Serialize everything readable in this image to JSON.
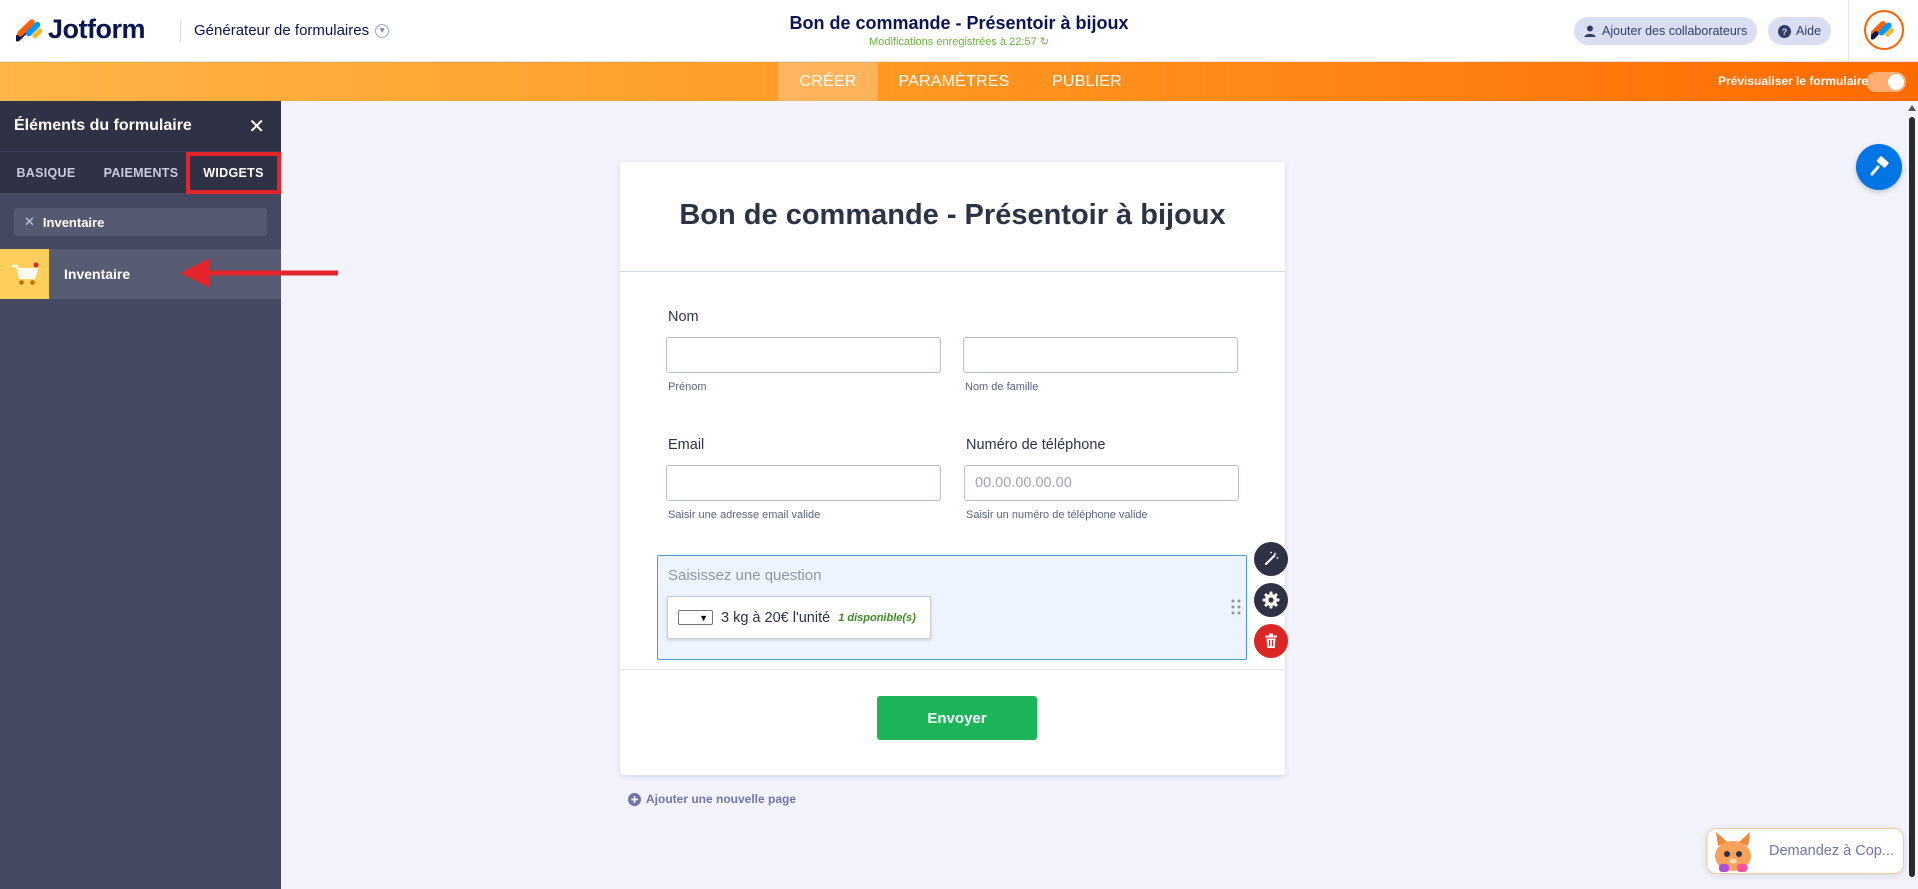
{
  "header": {
    "brand": "Jotform",
    "builder_title": "Générateur de formulaires",
    "form_title": "Bon de commande - Présentoir à bijoux",
    "save_status": "Modifications enregistrées à 22:57",
    "collab_label": "Ajouter des collaborateurs",
    "help_label": "Aide"
  },
  "nav": {
    "tabs": [
      {
        "label": "CRÉER",
        "active": true
      },
      {
        "label": "PARAMÈTRES",
        "active": false
      },
      {
        "label": "PUBLIER",
        "active": false
      }
    ],
    "preview_label": "Prévisualiser le formulaire",
    "preview_on": false
  },
  "panel": {
    "title": "Éléments du formulaire",
    "tabs": [
      {
        "label": "BASIQUE",
        "active": false
      },
      {
        "label": "PAIEMENTS",
        "active": false
      },
      {
        "label": "WIDGETS",
        "active": true
      }
    ],
    "search_value": "Inventaire",
    "results": [
      {
        "label": "Inventaire",
        "icon": "shopping-cart-icon"
      }
    ]
  },
  "form": {
    "title": "Bon de commande - Présentoir à bijoux",
    "name_label": "Nom",
    "first_sub": "Prénom",
    "last_sub": "Nom de famille",
    "email_label": "Email",
    "email_sub": "Saisir une adresse email valide",
    "phone_label": "Numéro de téléphone",
    "phone_placeholder": "00.00.00.00.00",
    "phone_sub": "Saisir un numéro de téléphone valide",
    "question_placeholder": "Saisissez une question",
    "inventory_item": "3 kg à 20€ l'unité",
    "inventory_available": "1 disponible(s)",
    "submit_label": "Envoyer",
    "add_page_label": "Ajouter une nouvelle page"
  },
  "ai_chat": {
    "label": "Demandez à Cop..."
  },
  "colors": {
    "brand_orange": "#ff6100",
    "panel_bg": "#44495f",
    "submit_green": "#1db55a",
    "highlight_red": "#e3252b",
    "designer_blue": "#0075e3"
  }
}
